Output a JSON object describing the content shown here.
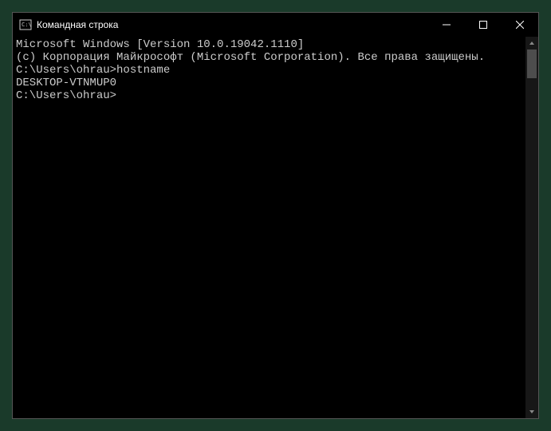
{
  "window": {
    "title": "Командная строка"
  },
  "console": {
    "line1": "Microsoft Windows [Version 10.0.19042.1110]",
    "line2": "(c) Корпорация Майкрософт (Microsoft Corporation). Все права защищены.",
    "blank1": "",
    "prompt1_full": "C:\\Users\\ohrau>hostname",
    "output1": "DESKTOP-VTNMUP0",
    "blank2": "",
    "prompt2_full": "C:\\Users\\ohrau>"
  }
}
